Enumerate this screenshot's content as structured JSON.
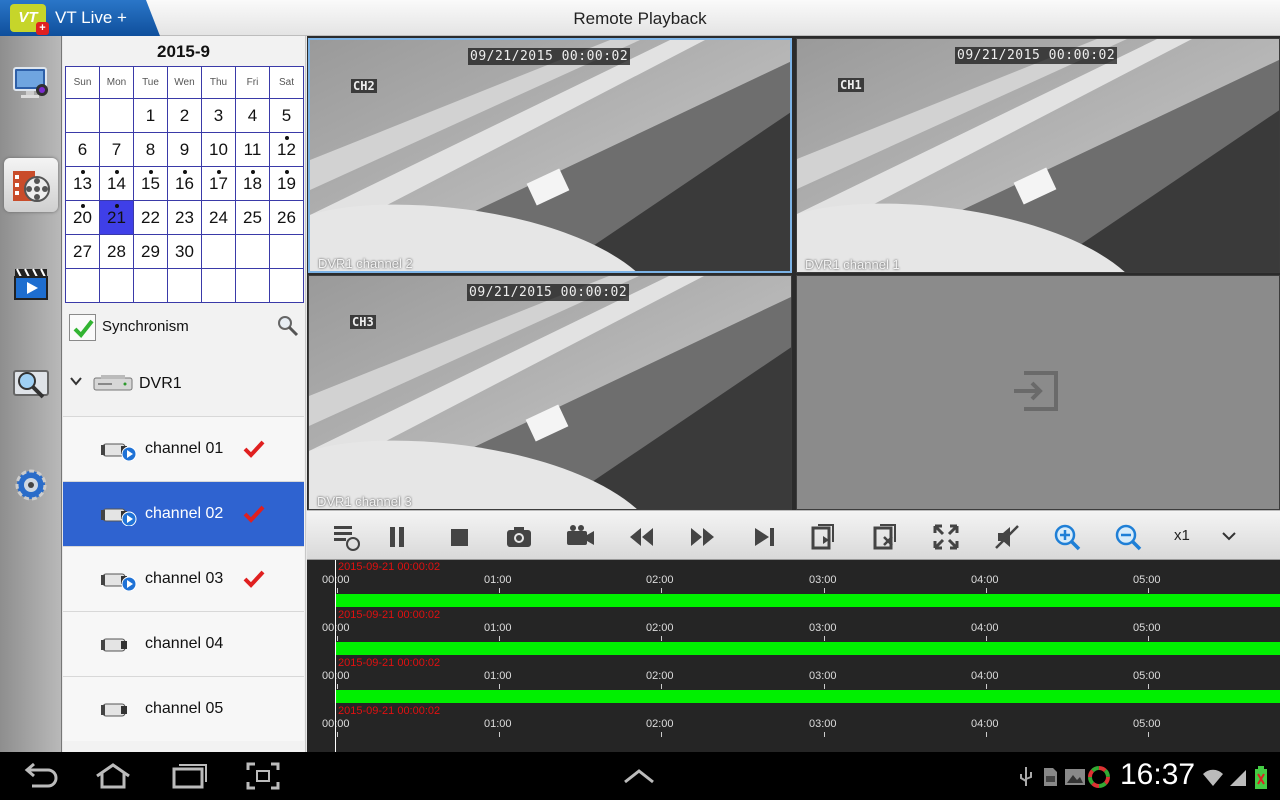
{
  "app": {
    "logo_text": "VT",
    "logo_plus": "+",
    "name": "VT Live +",
    "title": "Remote Playback"
  },
  "rail": [
    "monitor-icon",
    "playback-icon",
    "video-player-icon",
    "search-log-icon",
    "settings-icon"
  ],
  "calendar": {
    "title": "2015-9",
    "weekdays": [
      "Sun",
      "Mon",
      "Tue",
      "Wen",
      "Thu",
      "Fri",
      "Sat"
    ],
    "weeks": [
      [
        "",
        "",
        "1",
        "2",
        "3",
        "4",
        "5"
      ],
      [
        "6",
        "7",
        "8",
        "9",
        "10",
        "11",
        "12"
      ],
      [
        "13",
        "14",
        "15",
        "16",
        "17",
        "18",
        "19"
      ],
      [
        "20",
        "21",
        "22",
        "23",
        "24",
        "25",
        "26"
      ],
      [
        "27",
        "28",
        "29",
        "30",
        "",
        "",
        ""
      ],
      [
        "",
        "",
        "",
        "",
        "",
        "",
        ""
      ]
    ],
    "selected": "21",
    "days_with_records": [
      "12",
      "13",
      "14",
      "15",
      "16",
      "17",
      "18",
      "19",
      "20",
      "21"
    ]
  },
  "sync": {
    "label": "Synchronism",
    "checked": true
  },
  "device": {
    "name": "DVR1",
    "expanded": true
  },
  "channels": [
    {
      "label": "channel 01",
      "checked": true,
      "playing": true,
      "active": false
    },
    {
      "label": "channel 02",
      "checked": true,
      "playing": true,
      "active": true
    },
    {
      "label": "channel 03",
      "checked": true,
      "playing": true,
      "active": false
    },
    {
      "label": "channel 04",
      "checked": false,
      "playing": false,
      "active": false
    },
    {
      "label": "channel 05",
      "checked": false,
      "playing": false,
      "active": false
    }
  ],
  "tiles": [
    {
      "timestamp": "09/21/2015 00:00:02",
      "osd": "CH2",
      "name": "DVR1 channel 2",
      "focused": true
    },
    {
      "timestamp": "09/21/2015 00:00:02",
      "osd": "CH1",
      "name": "DVR1 channel 1",
      "focused": false
    },
    {
      "timestamp": "09/21/2015 00:00:02",
      "osd": "CH3",
      "name": "DVR1 channel 3",
      "focused": false
    },
    {
      "empty": true,
      "icon": "add-video-icon"
    }
  ],
  "toolbar": {
    "icons": [
      "playlist-icon",
      "pause-icon",
      "stop-icon",
      "snapshot-icon",
      "record-icon",
      "rewind-icon",
      "fast-forward-icon",
      "next-frame-icon",
      "prev-window-icon",
      "close-window-icon",
      "fullscreen-icon",
      "mute-icon",
      "zoom-in-icon",
      "zoom-out-icon"
    ],
    "speed": "x1",
    "speed_icon": "chevron-down-icon"
  },
  "timeline": {
    "hour_labels": [
      "00:00",
      "01:00",
      "02:00",
      "03:00",
      "04:00",
      "05:00"
    ],
    "tracks": [
      {
        "stamp": "2015-09-21 00:00:02",
        "has_recording": true
      },
      {
        "stamp": "2015-09-21 00:00:02",
        "has_recording": true
      },
      {
        "stamp": "2015-09-21 00:00:02",
        "has_recording": true
      },
      {
        "stamp": "2015-09-21 00:00:02",
        "has_recording": false
      }
    ],
    "record_color": "#00f000",
    "stamp_color": "#e01010"
  },
  "system": {
    "clock": "16:37"
  },
  "colors": {
    "accent": "#2f63d0",
    "calendar_selected": "#3f3fe8",
    "check": "#e02020"
  }
}
